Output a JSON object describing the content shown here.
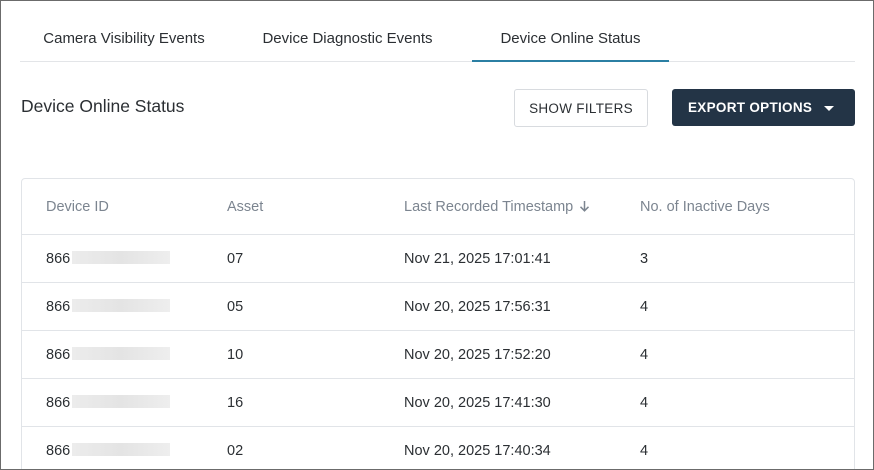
{
  "tabs": [
    {
      "label": "Camera Visibility Events",
      "active": false
    },
    {
      "label": "Device Diagnostic Events",
      "active": false
    },
    {
      "label": "Device Online Status",
      "active": true
    }
  ],
  "header": {
    "title": "Device Online Status",
    "show_filters_label": "SHOW FILTERS",
    "export_options_label": "EXPORT OPTIONS"
  },
  "table": {
    "columns": [
      "Device ID",
      "Asset",
      "Last Recorded Timestamp",
      "No. of Inactive Days"
    ],
    "sorted_column": "Last Recorded Timestamp",
    "sort_direction": "descending",
    "rows": [
      {
        "device_id": "866",
        "asset": "07",
        "timestamp": "Nov 21, 2025 17:01:41",
        "inactive_days": "3"
      },
      {
        "device_id": "866",
        "asset": "05",
        "timestamp": "Nov 20, 2025 17:56:31",
        "inactive_days": "4"
      },
      {
        "device_id": "866",
        "asset": "10",
        "timestamp": "Nov 20, 2025 17:52:20",
        "inactive_days": "4"
      },
      {
        "device_id": "866",
        "asset": "16",
        "timestamp": "Nov 20, 2025 17:41:30",
        "inactive_days": "4"
      },
      {
        "device_id": "866",
        "asset": "02",
        "timestamp": "Nov 20, 2025 17:40:34",
        "inactive_days": "4"
      }
    ]
  },
  "colors": {
    "tab_indicator": "#2b7fa3",
    "primary_button": "#233446"
  }
}
